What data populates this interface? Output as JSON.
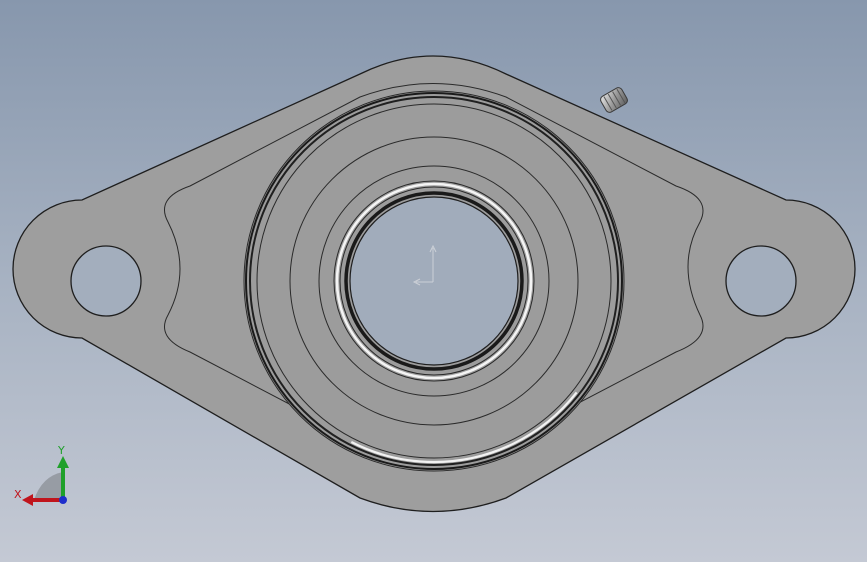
{
  "viewport": {
    "background_top": "#8797ad",
    "background_bottom": "#c4c9d4",
    "view": "front"
  },
  "model": {
    "part": "two-bolt-flange-bearing",
    "face_color": "#9e9e9e",
    "edge_color": "#1e1e1e",
    "highlight_color": "#f2f2f2",
    "components": [
      "flange-body",
      "bolt-hole-left",
      "bolt-hole-right",
      "bearing-housing",
      "inner-ring",
      "bore",
      "set-screw"
    ]
  },
  "triad": {
    "x_label": "X",
    "y_label": "Y",
    "x_color": "#c0141c",
    "y_color": "#1fa02a",
    "z_color": "#1e2ecc"
  },
  "origin": {
    "icon": "origin-icon"
  }
}
